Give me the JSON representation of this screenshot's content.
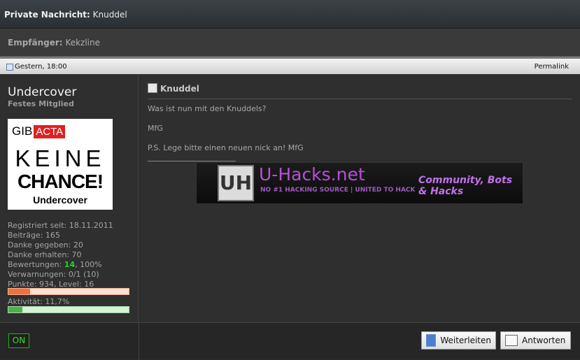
{
  "header": {
    "label": "Private Nachricht:",
    "title": "Knuddel"
  },
  "recipient": {
    "label": "Empfänger:",
    "name": "Kekzline"
  },
  "postbar": {
    "date": "Gestern, 18:00",
    "permalink": "Permalink"
  },
  "user": {
    "name": "Undercover",
    "rank": "Festes Mitglied",
    "avatar": {
      "line1": "GIB",
      "tile": "ACTA",
      "line2": "KEINE",
      "line3": "CHANCE!",
      "line4": "Undercover"
    },
    "stats": [
      "Registriert seit: 18.11.2011",
      "Beiträge: 165",
      "Danke gegeben: 20",
      "Danke erhalten: 70"
    ],
    "ratings_label": "Bewertungen:",
    "ratings_value": "14",
    "ratings_pct": ", 100%",
    "warnings": "Verwarnungen: 0/1 (10)",
    "points": "Punkte: 934, Level: 16",
    "points_progress": 0.18,
    "activity": "Aktivität: 11,7%",
    "activity_progress": 0.117
  },
  "post": {
    "title": "Knuddel",
    "lines": [
      "Was ist nun mit den Knuddels?",
      "MfG",
      "P.S. Lege bitte einen neuen nick an! MfG"
    ]
  },
  "banner": {
    "logo": "UH",
    "name": "U-Hacks.net",
    "tagline": "NO #1 HACKING SOURCE | UNITED TO HACK",
    "slogan": "Community, Bots & Hacks"
  },
  "footer": {
    "status": "ON",
    "forward": "Weiterleiten",
    "reply": "Antworten"
  },
  "colors": {
    "online": "#2ae02a",
    "rating": "#23d823",
    "banner_purple": "#b84fd8"
  }
}
